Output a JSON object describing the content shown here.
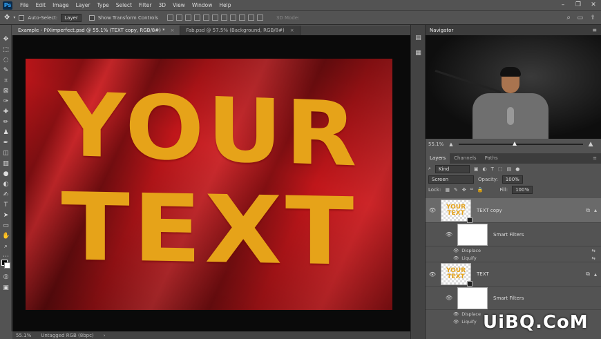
{
  "menubar": {
    "logo": "Ps",
    "items": [
      "File",
      "Edit",
      "Image",
      "Layer",
      "Type",
      "Select",
      "Filter",
      "3D",
      "View",
      "Window",
      "Help"
    ]
  },
  "options": {
    "auto_select_label": "Auto-Select:",
    "auto_select_target": "Layer",
    "show_transform_label": "Show Transform Controls",
    "mode_3d": "3D Mode:"
  },
  "document_tabs": [
    {
      "label": "Example - PiXimperfect.psd @ 55.1% (TEXT copy, RGB/8#) *",
      "active": true
    },
    {
      "label": "Fab.psd @ 57.5% (Background, RGB/8#)",
      "active": false
    }
  ],
  "artwork": {
    "line1": "YOUR",
    "line2": "TEXT"
  },
  "status": {
    "zoom": "55.1%",
    "profile": "Untagged RGB (8bpc)"
  },
  "navigator": {
    "title": "Navigator",
    "zoom": "55.1%"
  },
  "layers_panel": {
    "tabs": [
      "Layers",
      "Channels",
      "Paths"
    ],
    "filter": "Kind",
    "blend_mode": "Screen",
    "opacity_label": "Opacity:",
    "opacity_value": "100%",
    "lock_label": "Lock:",
    "fill_label": "Fill:",
    "fill_value": "100%",
    "layers": [
      {
        "name": "TEXT copy",
        "thumb": "YOUR TEXT",
        "selected": true
      },
      {
        "name": "Smart Filters",
        "filters": [
          "Displace",
          "Liquify"
        ]
      },
      {
        "name": "TEXT",
        "thumb": "YOUR TEXT",
        "selected": false
      },
      {
        "name": "Smart Filters",
        "filters": [
          "Displace",
          "Liquify"
        ]
      }
    ]
  },
  "watermark": "UiBQ.CoM"
}
